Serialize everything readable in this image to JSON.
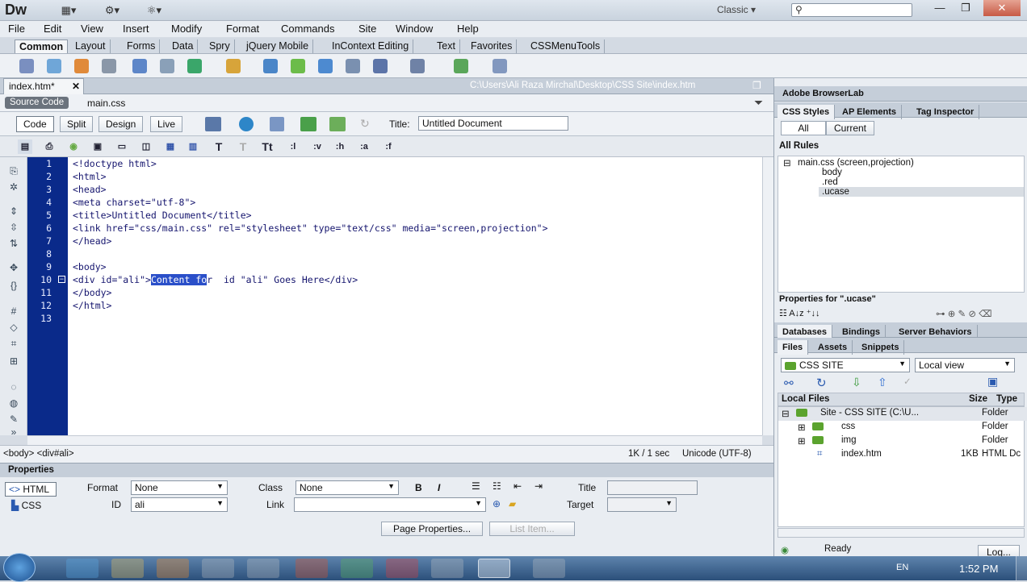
{
  "app": {
    "logo": "Dw",
    "workspace": "Classic",
    "search_icon": "search-icon"
  },
  "menu": [
    "File",
    "Edit",
    "View",
    "Insert",
    "Modify",
    "Format",
    "Commands",
    "Site",
    "Window",
    "Help"
  ],
  "insert_tabs": [
    "Common",
    "Layout",
    "Forms",
    "Data",
    "Spry",
    "jQuery Mobile",
    "InContext Editing",
    "Text",
    "Favorites",
    "CSSMenuTools"
  ],
  "document": {
    "tab_label": "index.htm*",
    "path": "C:\\Users\\Ali Raza Mirchal\\Desktop\\CSS Site\\index.htm",
    "source_code": "Source Code",
    "related_file": "main.css",
    "views": [
      "Code",
      "Split",
      "Design",
      "Live"
    ],
    "title_label": "Title:",
    "title_value": "Untitled Document"
  },
  "code_lines": [
    "<!doctype html>",
    "<html>",
    "<head>",
    "<meta charset=\"utf-8\">",
    "<title>Untitled Document</title>",
    "<link href=\"css/main.css\" rel=\"stylesheet\" type=\"text/css\" media=\"screen,projection\">",
    "</head>",
    "",
    "<body>",
    "<div id=\"ali\">",
    "</body>",
    "</html>",
    ""
  ],
  "line10": {
    "before": "<div id=\"ali\">",
    "selected": "Content fo",
    "after": "r  id \"ali\" Goes Here</div>"
  },
  "line_numbers": [
    "1",
    "2",
    "3",
    "4",
    "5",
    "6",
    "7",
    "8",
    "9",
    "10",
    "11",
    "12",
    "13"
  ],
  "status": {
    "tag_selector": "<body> <div#ali>",
    "doc_size": "1K / 1 sec",
    "encoding": "Unicode (UTF-8)"
  },
  "properties": {
    "header": "Properties",
    "html_btn": "HTML",
    "css_btn": "CSS",
    "format_label": "Format",
    "format_value": "None",
    "class_label": "Class",
    "class_value": "None",
    "id_label": "ID",
    "id_value": "ali",
    "link_label": "Link",
    "title_label": "Title",
    "target_label": "Target",
    "page_props": "Page Properties...",
    "list_item": "List Item..."
  },
  "right_panel": {
    "browserlab": "Adobe BrowserLab",
    "css_tabs": [
      "CSS Styles",
      "AP Elements",
      "Tag Inspector"
    ],
    "mode_all": "All",
    "mode_current": "Current",
    "all_rules": "All Rules",
    "rules_root": "main.css (screen,projection)",
    "rules": [
      "body",
      ".red",
      ".ucase"
    ],
    "properties_for": "Properties for \".ucase\"",
    "db_tabs": [
      "Databases",
      "Bindings",
      "Server Behaviors"
    ],
    "files_tabs": [
      "Files",
      "Assets",
      "Snippets"
    ],
    "site_select": "CSS SITE",
    "view_select": "Local view",
    "col_local": "Local Files",
    "col_size": "Size",
    "col_type": "Type",
    "files": [
      {
        "name": "Site - CSS SITE (C:\\U...",
        "size": "",
        "type": "Folder"
      },
      {
        "name": "css",
        "size": "",
        "type": "Folder"
      },
      {
        "name": "img",
        "size": "",
        "type": "Folder"
      },
      {
        "name": "index.htm",
        "size": "1KB",
        "type": "HTML Dc"
      }
    ],
    "ready": "Ready",
    "log_btn": "Log..."
  },
  "taskbar": {
    "lang": "EN",
    "clock": "1:52 PM"
  }
}
